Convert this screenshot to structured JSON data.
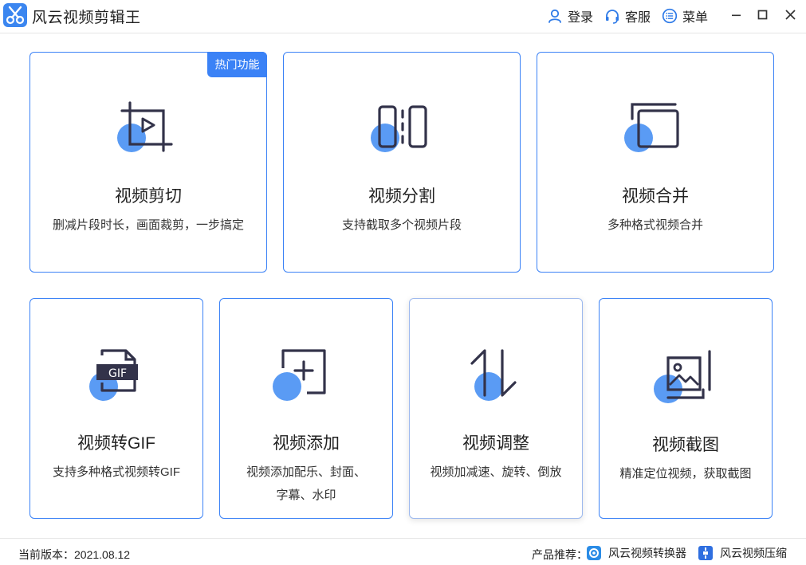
{
  "app": {
    "title": "风云视频剪辑王",
    "icon": "scissors-icon",
    "accent_color": "#3b86f0"
  },
  "header": {
    "login_label": "登录",
    "service_label": "客服",
    "menu_label": "菜单",
    "controls": [
      "minimize-icon",
      "maximize-icon",
      "close-icon"
    ]
  },
  "cards": [
    {
      "title": "视频剪切",
      "desc": "删减片段时长，画面裁剪，一步搞定",
      "icon": "crop-play-icon",
      "badge": "热门功能"
    },
    {
      "title": "视频分割",
      "desc": "支持截取多个视频片段",
      "icon": "split-icon"
    },
    {
      "title": "视频合并",
      "desc": "多种格式视频合并",
      "icon": "merge-icon"
    },
    {
      "title": "视频转GIF",
      "desc": "支持多种格式视频转GIF",
      "icon": "gif-file-icon"
    },
    {
      "title": "视频添加",
      "desc": "视频添加配乐、封面、字幕、水印",
      "icon": "add-icon"
    },
    {
      "title": "视频调整",
      "desc": "视频加减速、旋转、倒放",
      "icon": "adjust-arrows-icon"
    },
    {
      "title": "视频截图",
      "desc": "精准定位视频，获取截图",
      "icon": "screenshot-icon"
    }
  ],
  "footer": {
    "version_label": "当前版本：2021.08.12",
    "recommend_label": "产品推荐：",
    "products": [
      {
        "name": "风云视频转换器",
        "icon": "converter-icon"
      },
      {
        "name": "风云视频压缩",
        "icon": "compress-icon"
      }
    ]
  }
}
